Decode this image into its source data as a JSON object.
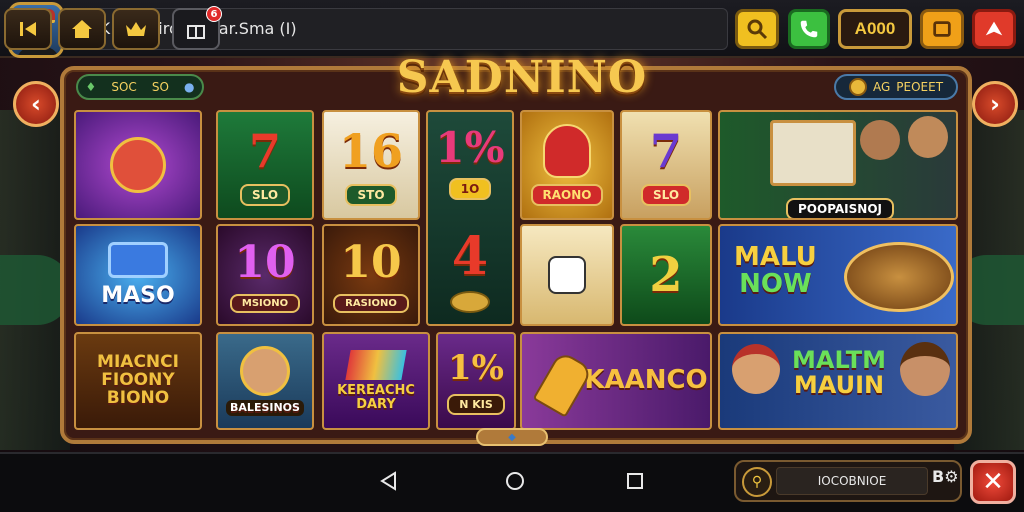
{
  "topbar": {
    "title": "APK Innosiro. (Aclar.Sma (I)",
    "coins": "A000"
  },
  "logo": "SADNINO",
  "left_pill": {
    "a": "SOC",
    "b": "SO"
  },
  "right_pill": {
    "a": "AG",
    "b": "PEOEET"
  },
  "tiles": {
    "t1_label": "",
    "t2_big": "7",
    "t2_tag": "SLO",
    "t3_big": "16",
    "t3_tag": "STO",
    "t4_big": "1%",
    "t4_tag": "1O",
    "t5_label": "RAONO",
    "t6_big": "7",
    "t6_tag": "SLO",
    "t7_label": "POOPAISNOJ",
    "t8_label": "MASO",
    "t9_big": "10",
    "t9_tag": "MSIONO",
    "t10_big": "10",
    "t10_tag": "RASIONO",
    "t11_big": "4",
    "t12_label": "",
    "t13_big": "2",
    "t14_label_a": "MALU",
    "t14_label_b": "NOW",
    "t15_label": "MIACNCI FIOONY BIONO",
    "t16_label": "BALESINOS",
    "t17_label": "KEREACHC DARY",
    "t18_big": "1%",
    "t18_tag": "N KIS",
    "t19_label": "KAANCO",
    "t20_label_a": "MALTM",
    "t20_label_b": "MAUIN"
  },
  "bottom": {
    "search_value": "IOCOBNIOE",
    "side_label": "B",
    "badge": "6"
  },
  "colors": {
    "gold": "#f6c850",
    "frame": "#b07a3a",
    "green": "#3cc040",
    "red": "#e03a2a"
  }
}
